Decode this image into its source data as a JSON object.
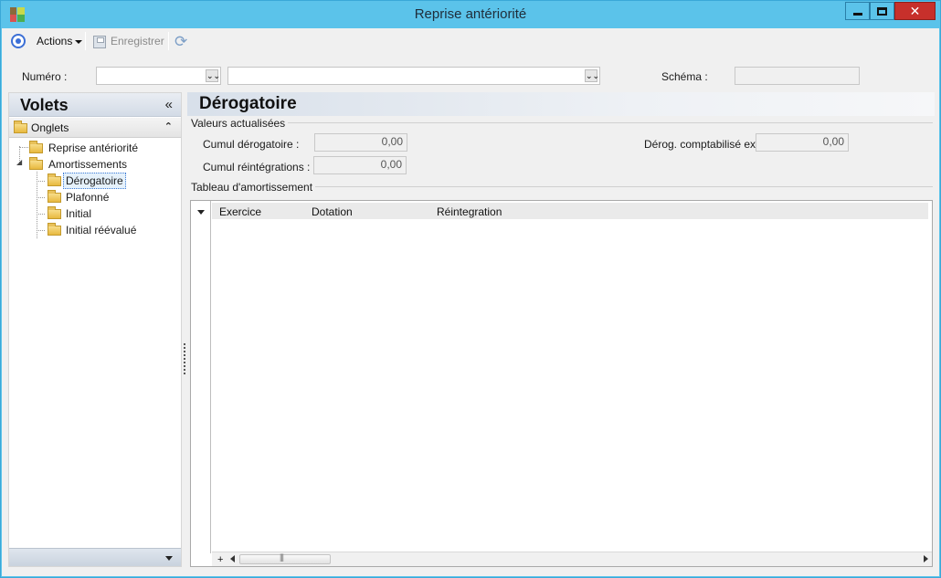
{
  "window": {
    "title": "Reprise antériorité",
    "close_glyph": "✕"
  },
  "toolbar": {
    "actions_label": "Actions",
    "save_label": "Enregistrer",
    "refresh_glyph": "⟳"
  },
  "header": {
    "numero_label": "Numéro :",
    "schema_label": "Schéma :",
    "numero_value": "",
    "desc_value": "",
    "schema_value": ""
  },
  "volets": {
    "title": "Volets",
    "collapse_glyph": "«",
    "section_label": "Onglets",
    "section_toggle_glyph": "⌃",
    "expand_glyph": "◢",
    "tree": [
      {
        "label": "Reprise antériorité"
      },
      {
        "label": "Amortissements"
      },
      {
        "label": "Dérogatoire"
      },
      {
        "label": "Plafonné"
      },
      {
        "label": "Initial"
      },
      {
        "label": "Initial réévalué"
      }
    ]
  },
  "page": {
    "title": "Dérogatoire",
    "group_valeurs": "Valeurs actualisées",
    "cumul_derog_label": "Cumul dérogatoire :",
    "cumul_derog_value": "0,00",
    "cumul_reint_label": "Cumul réintégrations :",
    "cumul_reint_value": "0,00",
    "derog_compta_label": "Dérog. comptabilisé ex. :",
    "derog_compta_value": "0,00",
    "group_tableau": "Tableau d'amortissement",
    "grid_columns": [
      "Exercice",
      "Dotation",
      "Réintegration"
    ],
    "grid_add_glyph": "+"
  }
}
